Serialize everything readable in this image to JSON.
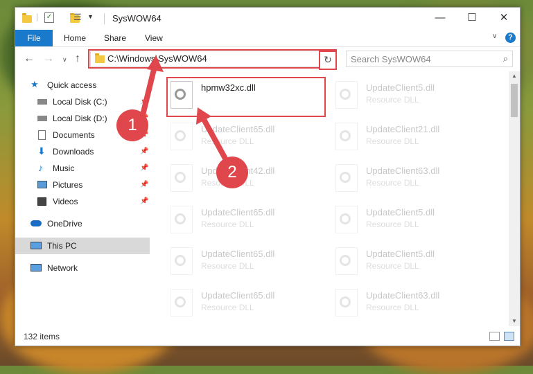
{
  "window": {
    "title": "SysWOW64"
  },
  "ribbon": {
    "tabs": [
      "File",
      "Home",
      "Share",
      "View"
    ]
  },
  "nav": {
    "address": "C:\\Windows\\SysWOW64",
    "search_placeholder": "Search SysWOW64"
  },
  "sidebar": {
    "items": [
      {
        "label": "Quick access",
        "icon": "star-icon",
        "pinned": false
      },
      {
        "label": "Local Disk (C:)",
        "icon": "drive-icon",
        "pinned": true
      },
      {
        "label": "Local Disk (D:)",
        "icon": "drive-icon",
        "pinned": true
      },
      {
        "label": "Documents",
        "icon": "documents-icon",
        "pinned": true
      },
      {
        "label": "Downloads",
        "icon": "download-icon",
        "pinned": true
      },
      {
        "label": "Music",
        "icon": "music-icon",
        "pinned": true
      },
      {
        "label": "Pictures",
        "icon": "pictures-icon",
        "pinned": true
      },
      {
        "label": "Videos",
        "icon": "videos-icon",
        "pinned": true
      },
      {
        "label": "OneDrive",
        "icon": "cloud-icon",
        "pinned": false
      },
      {
        "label": "This PC",
        "icon": "computer-icon",
        "pinned": false
      },
      {
        "label": "Network",
        "icon": "network-icon",
        "pinned": false
      }
    ]
  },
  "files": [
    {
      "name": "hpmw32xc.dll",
      "type": ""
    },
    {
      "name": "UpdateClient5.dll",
      "type": "Resource DLL"
    },
    {
      "name": "UpdateClient65.dll",
      "type": "Resource DLL"
    },
    {
      "name": "UpdateClient21.dll",
      "type": "Resource DLL"
    },
    {
      "name": "UpdateClient42.dll",
      "type": "Resource DLL"
    },
    {
      "name": "UpdateClient63.dll",
      "type": "Resource DLL"
    },
    {
      "name": "UpdateClient65.dll",
      "type": "Resource DLL"
    },
    {
      "name": "UpdateClient5.dll",
      "type": "Resource DLL"
    },
    {
      "name": "UpdateClient65.dll",
      "type": "Resource DLL"
    },
    {
      "name": "UpdateClient5.dll",
      "type": "Resource DLL"
    },
    {
      "name": "UpdateClient65.dll",
      "type": "Resource DLL"
    },
    {
      "name": "UpdateClient63.dll",
      "type": "Resource DLL"
    }
  ],
  "status": {
    "item_count": "132 items"
  },
  "annotations": {
    "step1": "1",
    "step2": "2",
    "color": "#e0474c"
  },
  "colors": {
    "accent": "#1979ca",
    "highlight": "#e0474c"
  }
}
